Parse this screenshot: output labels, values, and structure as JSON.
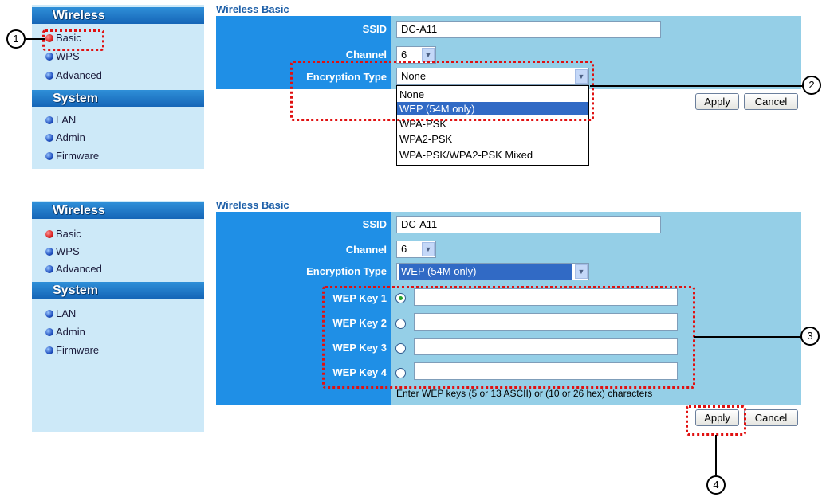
{
  "top": {
    "sidebar": {
      "wireless_heading": "Wireless",
      "system_heading": "System",
      "items": [
        "Basic",
        "WPS",
        "Advanced",
        "LAN",
        "Admin",
        "Firmware"
      ]
    },
    "title": "Wireless Basic",
    "ssid_label": "SSID",
    "ssid_value": "DC-A11",
    "channel_label": "Channel",
    "channel_value": "6",
    "encryption_label": "Encryption Type",
    "encryption_value": "None",
    "dropdown_options": [
      "None",
      "WEP (54M only)",
      "WPA-PSK",
      "WPA2-PSK",
      "WPA-PSK/WPA2-PSK Mixed"
    ],
    "highlighted_option": "WEP (54M only)",
    "apply": "Apply",
    "cancel": "Cancel"
  },
  "bottom": {
    "sidebar": {
      "wireless_heading": "Wireless",
      "system_heading": "System",
      "items": [
        "Basic",
        "WPS",
        "Advanced",
        "LAN",
        "Admin",
        "Firmware"
      ]
    },
    "title": "Wireless Basic",
    "ssid_label": "SSID",
    "ssid_value": "DC-A11",
    "channel_label": "Channel",
    "channel_value": "6",
    "encryption_label": "Encryption Type",
    "encryption_value": "WEP (54M only)",
    "wep_keys": [
      {
        "label": "WEP Key 1",
        "selected": true,
        "value": ""
      },
      {
        "label": "WEP Key 2",
        "selected": false,
        "value": ""
      },
      {
        "label": "WEP Key 3",
        "selected": false,
        "value": ""
      },
      {
        "label": "WEP Key 4",
        "selected": false,
        "value": ""
      }
    ],
    "hint": "Enter WEP keys (5 or 13 ASCII) or (10 or 26 hex) characters",
    "apply": "Apply",
    "cancel": "Cancel"
  },
  "callouts": [
    "1",
    "2",
    "3",
    "4"
  ],
  "colors": {
    "label_column": "#1f8fe6",
    "value_column": "#95cfe7",
    "sidebar_bg": "#cde9f8",
    "title_text": "#1d5fa8",
    "highlight_dash": "#e01010",
    "selection": "#316ac5"
  }
}
